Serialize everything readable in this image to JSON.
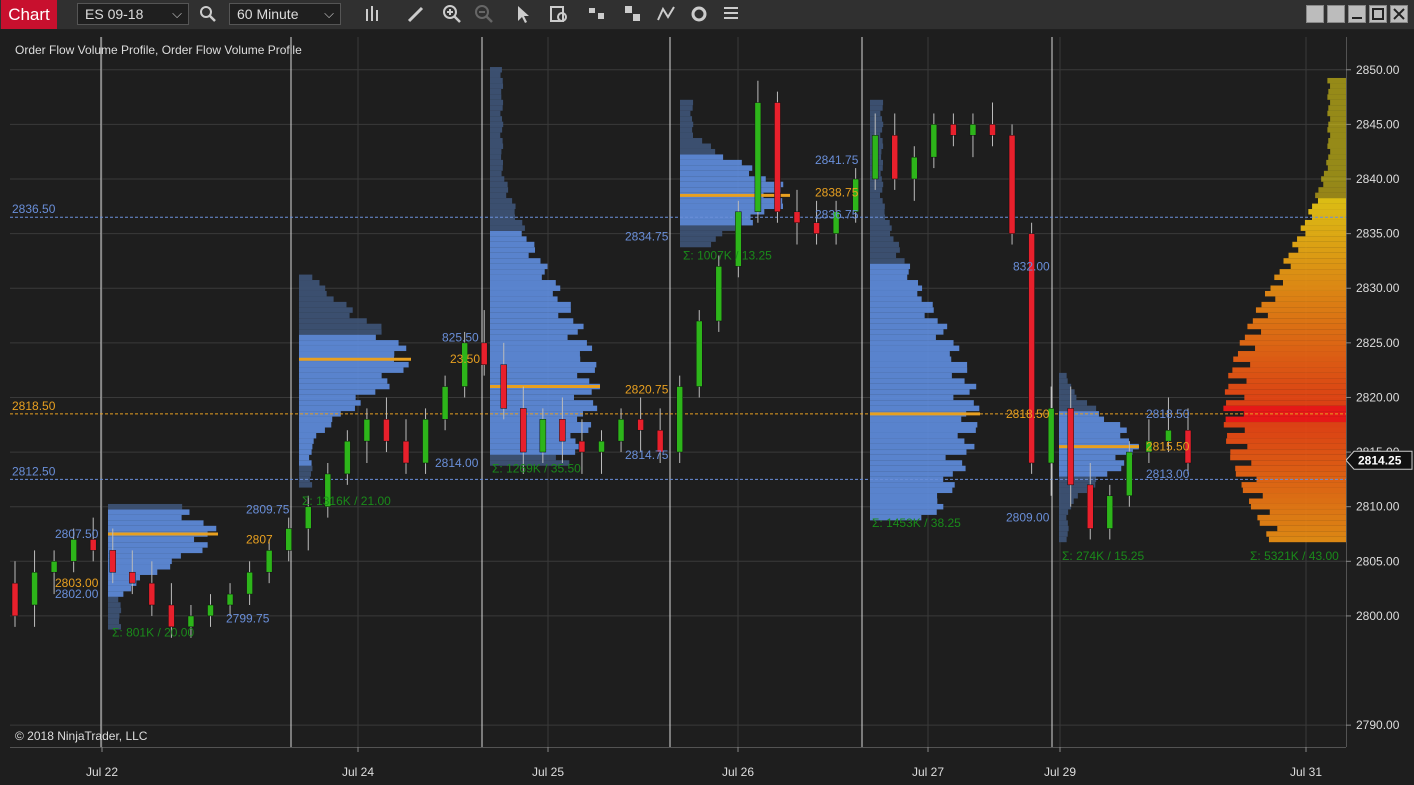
{
  "window": {
    "tab_label": "Chart",
    "instrument": "ES 09-18",
    "timeframe": "60 Minute",
    "toolbar_icons": [
      "search-icon",
      "bar-chart-icon",
      "pencil-icon",
      "zoom-in-icon",
      "zoom-out-icon",
      "pointer-icon",
      "data-box-icon",
      "chart-style-icon",
      "tiles-icon",
      "strategy-icon",
      "refresh-icon",
      "list-icon"
    ],
    "window_buttons": [
      "tile-button",
      "tile-button-2",
      "minimize-button",
      "maximize-button",
      "close-button"
    ]
  },
  "chart": {
    "indicator_label": "Order Flow Volume Profile, Order Flow Volume Profile",
    "copyright": "© 2018 NinjaTrader, LLC",
    "current_price": "2814.25",
    "colors": {
      "up": "#2db51a",
      "down": "#e8202c",
      "profile": "#5f8ee0",
      "poc": "#e8a020",
      "value_area_line": "#6a8fd9",
      "sum_text": "#1a8a1a",
      "grid": "#3a3a3a",
      "session_line": "#d8d8d8"
    }
  },
  "chart_data": {
    "type": "candlestick",
    "ylim": [
      2788,
      2853
    ],
    "y_ticks": [
      "2850.00",
      "2845.00",
      "2840.00",
      "2835.00",
      "2830.00",
      "2825.00",
      "2820.00",
      "2815.00",
      "2810.00",
      "2805.00",
      "2800.00",
      "2790.00"
    ],
    "x_ticks": [
      "Jul 22",
      "Jul 24",
      "Jul 25",
      "Jul 26",
      "Jul 27",
      "Jul 29",
      "Jul 31"
    ],
    "horizontal_levels": [
      {
        "label": "2836.50",
        "value": 2836.5,
        "type": "va"
      },
      {
        "label": "2818.50",
        "value": 2818.5,
        "type": "poc"
      },
      {
        "label": "2812.50",
        "value": 2812.5,
        "type": "va"
      }
    ],
    "profile_labels": [
      {
        "text": "2807.50",
        "kind": "va"
      },
      {
        "text": "2803.00",
        "kind": "poc"
      },
      {
        "text": "2802.00",
        "kind": "va"
      },
      {
        "text": "2809.75",
        "kind": "va"
      },
      {
        "text": "2807",
        "kind": "poc"
      },
      {
        "text": "2799.75",
        "kind": "va"
      },
      {
        "text": "825.50",
        "kind": "va"
      },
      {
        "text": "23.50",
        "kind": "poc"
      },
      {
        "text": "2814.00",
        "kind": "va"
      },
      {
        "text": "2834.75",
        "kind": "va"
      },
      {
        "text": "2820.75",
        "kind": "poc"
      },
      {
        "text": "2814.75",
        "kind": "va"
      },
      {
        "text": "2841.75",
        "kind": "va"
      },
      {
        "text": "2838.75",
        "kind": "poc"
      },
      {
        "text": "2836.75",
        "kind": "va"
      },
      {
        "text": "832.00",
        "kind": "va"
      },
      {
        "text": "2818.50",
        "kind": "poc"
      },
      {
        "text": "2809.00",
        "kind": "va"
      },
      {
        "text": "2818.50",
        "kind": "va"
      },
      {
        "text": "2815.50",
        "kind": "poc"
      },
      {
        "text": "2813.00",
        "kind": "va"
      }
    ],
    "session_summaries": [
      "Σ: 801K / 20.00",
      "Σ: 1316K / 21.00",
      "Σ: 1269K / 35.50",
      "Σ: 1007K / 13.25",
      "Σ: 1453K / 38.25",
      "Σ: 274K / 15.25",
      "Σ: 5321K / 43.00"
    ],
    "candles": [
      {
        "o": 2803,
        "h": 2805,
        "l": 2799,
        "c": 2800
      },
      {
        "o": 2801,
        "h": 2806,
        "l": 2799,
        "c": 2804
      },
      {
        "o": 2804,
        "h": 2806,
        "l": 2802,
        "c": 2805
      },
      {
        "o": 2805,
        "h": 2808,
        "l": 2804,
        "c": 2807
      },
      {
        "o": 2807,
        "h": 2809,
        "l": 2805,
        "c": 2806
      },
      {
        "o": 2806,
        "h": 2808,
        "l": 2803,
        "c": 2804
      },
      {
        "o": 2804,
        "h": 2806,
        "l": 2802,
        "c": 2803
      },
      {
        "o": 2803,
        "h": 2805,
        "l": 2800,
        "c": 2801
      },
      {
        "o": 2801,
        "h": 2803,
        "l": 2798,
        "c": 2799
      },
      {
        "o": 2799,
        "h": 2801,
        "l": 2798,
        "c": 2800
      },
      {
        "o": 2800,
        "h": 2802,
        "l": 2799,
        "c": 2801
      },
      {
        "o": 2801,
        "h": 2803,
        "l": 2800,
        "c": 2802
      },
      {
        "o": 2802,
        "h": 2805,
        "l": 2801,
        "c": 2804
      },
      {
        "o": 2804,
        "h": 2807,
        "l": 2803,
        "c": 2806
      },
      {
        "o": 2806,
        "h": 2809,
        "l": 2805,
        "c": 2808
      },
      {
        "o": 2808,
        "h": 2811,
        "l": 2806,
        "c": 2810
      },
      {
        "o": 2810,
        "h": 2814,
        "l": 2809,
        "c": 2813
      },
      {
        "o": 2813,
        "h": 2817,
        "l": 2812,
        "c": 2816
      },
      {
        "o": 2816,
        "h": 2819,
        "l": 2814,
        "c": 2818
      },
      {
        "o": 2818,
        "h": 2820,
        "l": 2815,
        "c": 2816
      },
      {
        "o": 2816,
        "h": 2818,
        "l": 2813,
        "c": 2814
      },
      {
        "o": 2814,
        "h": 2819,
        "l": 2813,
        "c": 2818
      },
      {
        "o": 2818,
        "h": 2822,
        "l": 2817,
        "c": 2821
      },
      {
        "o": 2821,
        "h": 2826,
        "l": 2820,
        "c": 2825
      },
      {
        "o": 2825,
        "h": 2828,
        "l": 2822,
        "c": 2823
      },
      {
        "o": 2823,
        "h": 2825,
        "l": 2818,
        "c": 2819
      },
      {
        "o": 2819,
        "h": 2821,
        "l": 2813,
        "c": 2815
      },
      {
        "o": 2815,
        "h": 2819,
        "l": 2814,
        "c": 2818
      },
      {
        "o": 2818,
        "h": 2820,
        "l": 2814,
        "c": 2816
      },
      {
        "o": 2816,
        "h": 2818,
        "l": 2813,
        "c": 2815
      },
      {
        "o": 2815,
        "h": 2817,
        "l": 2813,
        "c": 2816
      },
      {
        "o": 2816,
        "h": 2819,
        "l": 2815,
        "c": 2818
      },
      {
        "o": 2818,
        "h": 2820,
        "l": 2815,
        "c": 2817
      },
      {
        "o": 2817,
        "h": 2819,
        "l": 2814,
        "c": 2815
      },
      {
        "o": 2815,
        "h": 2822,
        "l": 2814,
        "c": 2821
      },
      {
        "o": 2821,
        "h": 2828,
        "l": 2820,
        "c": 2827
      },
      {
        "o": 2827,
        "h": 2833,
        "l": 2826,
        "c": 2832
      },
      {
        "o": 2832,
        "h": 2838,
        "l": 2831,
        "c": 2837
      },
      {
        "o": 2837,
        "h": 2849,
        "l": 2836,
        "c": 2847
      },
      {
        "o": 2847,
        "h": 2848,
        "l": 2836,
        "c": 2837
      },
      {
        "o": 2837,
        "h": 2839,
        "l": 2834,
        "c": 2836
      },
      {
        "o": 2836,
        "h": 2838,
        "l": 2834,
        "c": 2835
      },
      {
        "o": 2835,
        "h": 2838,
        "l": 2834,
        "c": 2837
      },
      {
        "o": 2837,
        "h": 2841,
        "l": 2836,
        "c": 2840
      },
      {
        "o": 2840,
        "h": 2846,
        "l": 2839,
        "c": 2844
      },
      {
        "o": 2844,
        "h": 2846,
        "l": 2839,
        "c": 2840
      },
      {
        "o": 2840,
        "h": 2843,
        "l": 2838,
        "c": 2842
      },
      {
        "o": 2842,
        "h": 2846,
        "l": 2841,
        "c": 2845
      },
      {
        "o": 2845,
        "h": 2846,
        "l": 2843,
        "c": 2844
      },
      {
        "o": 2844,
        "h": 2846,
        "l": 2842,
        "c": 2845
      },
      {
        "o": 2845,
        "h": 2847,
        "l": 2843,
        "c": 2844
      },
      {
        "o": 2844,
        "h": 2845,
        "l": 2834,
        "c": 2835
      },
      {
        "o": 2835,
        "h": 2836,
        "l": 2813,
        "c": 2814
      },
      {
        "o": 2814,
        "h": 2821,
        "l": 2811,
        "c": 2819
      },
      {
        "o": 2819,
        "h": 2821,
        "l": 2810,
        "c": 2812
      },
      {
        "o": 2812,
        "h": 2814,
        "l": 2807,
        "c": 2808
      },
      {
        "o": 2808,
        "h": 2812,
        "l": 2807,
        "c": 2811
      },
      {
        "o": 2811,
        "h": 2816,
        "l": 2810,
        "c": 2815
      },
      {
        "o": 2815,
        "h": 2818,
        "l": 2814,
        "c": 2816
      },
      {
        "o": 2816,
        "h": 2820,
        "l": 2815,
        "c": 2817
      },
      {
        "o": 2817,
        "h": 2819,
        "l": 2813,
        "c": 2814
      }
    ]
  }
}
